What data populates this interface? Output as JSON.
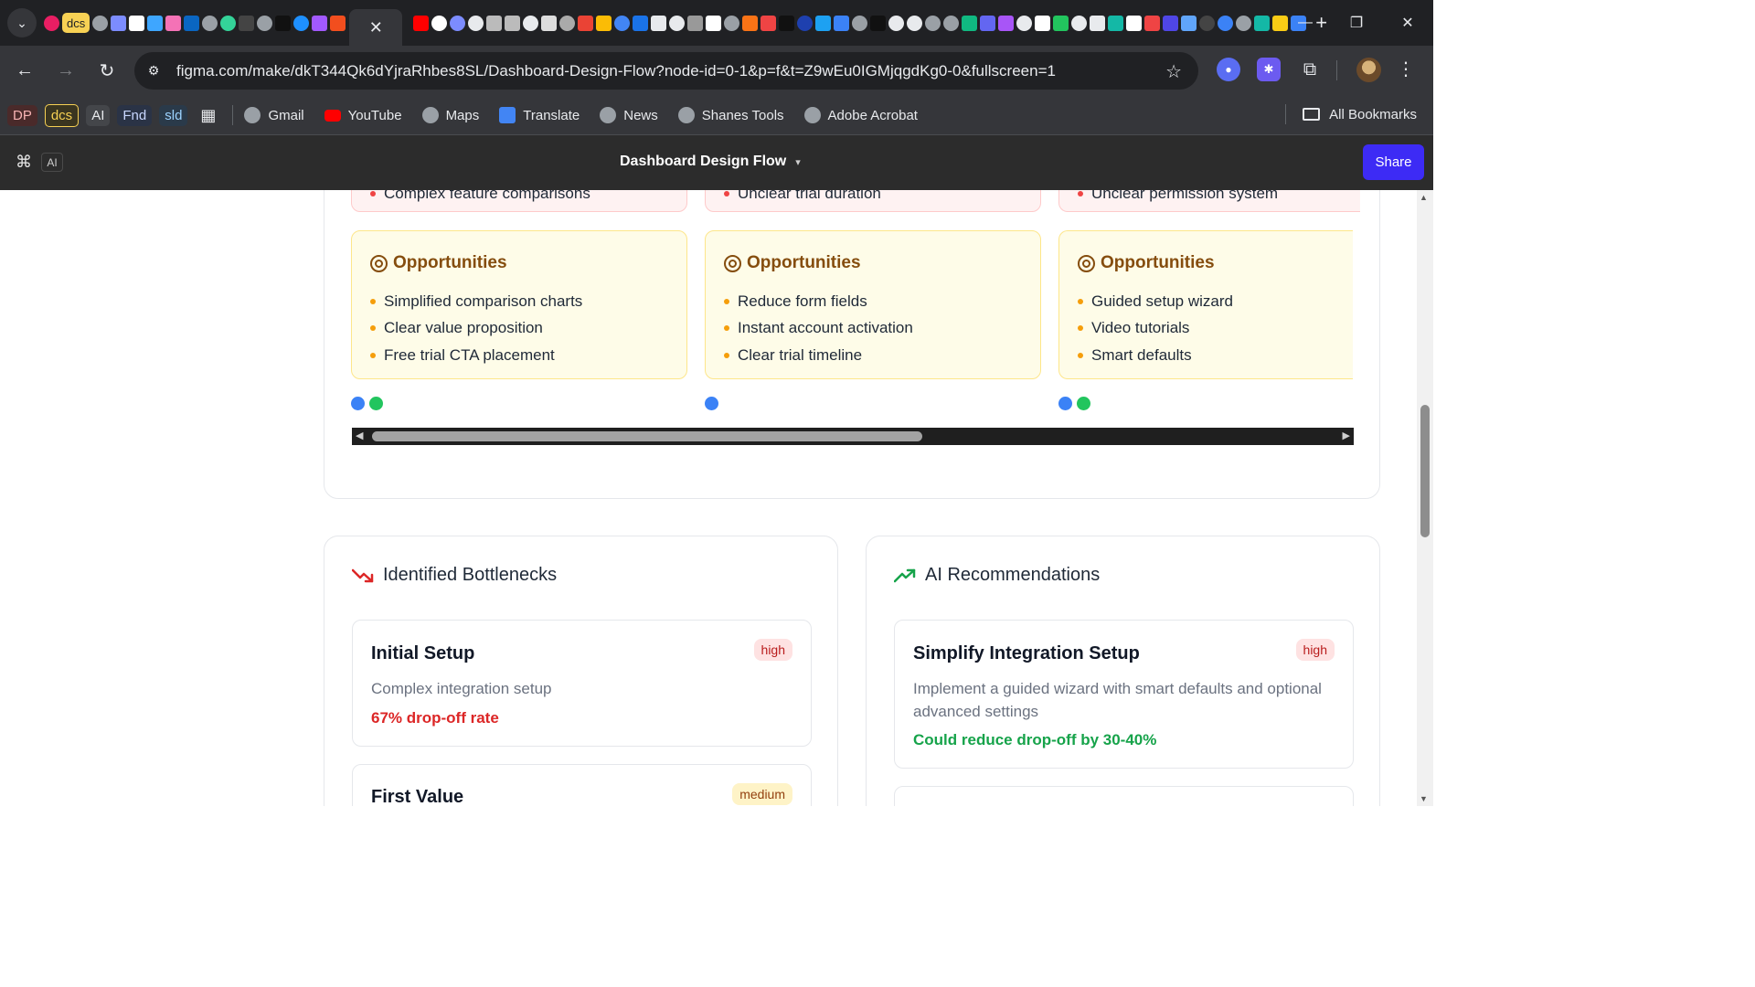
{
  "browser": {
    "tab_strip_badge": "dcs",
    "active_tab_close": "✕",
    "new_tab": "+",
    "url": "figma.com/make/dkT344Qk6dYjraRhbes8SL/Dashboard-Design-Flow?node-id=0-1&p=f&t=Z9wEu0IGMjqgdKg0-0&fullscreen=1",
    "bookmarks": {
      "chips": [
        "DP",
        "dcs",
        "AI",
        "Fnd",
        "sld"
      ],
      "items": [
        "Gmail",
        "YouTube",
        "Maps",
        "Translate",
        "News",
        "Shanes Tools",
        "Adobe Acrobat"
      ],
      "all_bookmarks": "All Bookmarks"
    }
  },
  "figma": {
    "ai_badge": "AI",
    "file_title": "Dashboard Design Flow",
    "share_label": "Share"
  },
  "journey": {
    "stages": [
      {
        "pain_last": "Complex feature comparisons",
        "opportunities_title": "Opportunities",
        "opportunities": [
          "Simplified comparison charts",
          "Clear value proposition",
          "Free trial CTA placement"
        ],
        "dots": [
          "blue",
          "green"
        ]
      },
      {
        "pain_last": "Unclear trial duration",
        "opportunities_title": "Opportunities",
        "opportunities": [
          "Reduce form fields",
          "Instant account activation",
          "Clear trial timeline"
        ],
        "dots": [
          "blue"
        ]
      },
      {
        "pain_last": "Unclear permission system",
        "opportunities_title": "Opportunities",
        "opportunities": [
          "Guided setup wizard",
          "Video tutorials",
          "Smart defaults"
        ],
        "dots": [
          "blue",
          "green"
        ]
      }
    ]
  },
  "bottlenecks": {
    "title": "Identified Bottlenecks",
    "items": [
      {
        "title": "Initial Setup",
        "severity": "high",
        "description": "Complex integration setup",
        "metric": "67% drop-off rate"
      },
      {
        "title": "First Value",
        "severity": "medium"
      }
    ]
  },
  "recommendations": {
    "title": "AI Recommendations",
    "items": [
      {
        "title": "Simplify Integration Setup",
        "priority": "high",
        "description": "Implement a guided wizard with smart defaults and optional advanced settings",
        "impact": "Could reduce drop-off by 30-40%"
      }
    ]
  },
  "colors": {
    "share_button": "#3d2bf5",
    "pain_bg": "#fef2f2",
    "opportunity_bg": "#fefce8",
    "opportunity_heading": "#854d0e",
    "metric_red": "#dc2626",
    "impact_green": "#16a34a"
  }
}
